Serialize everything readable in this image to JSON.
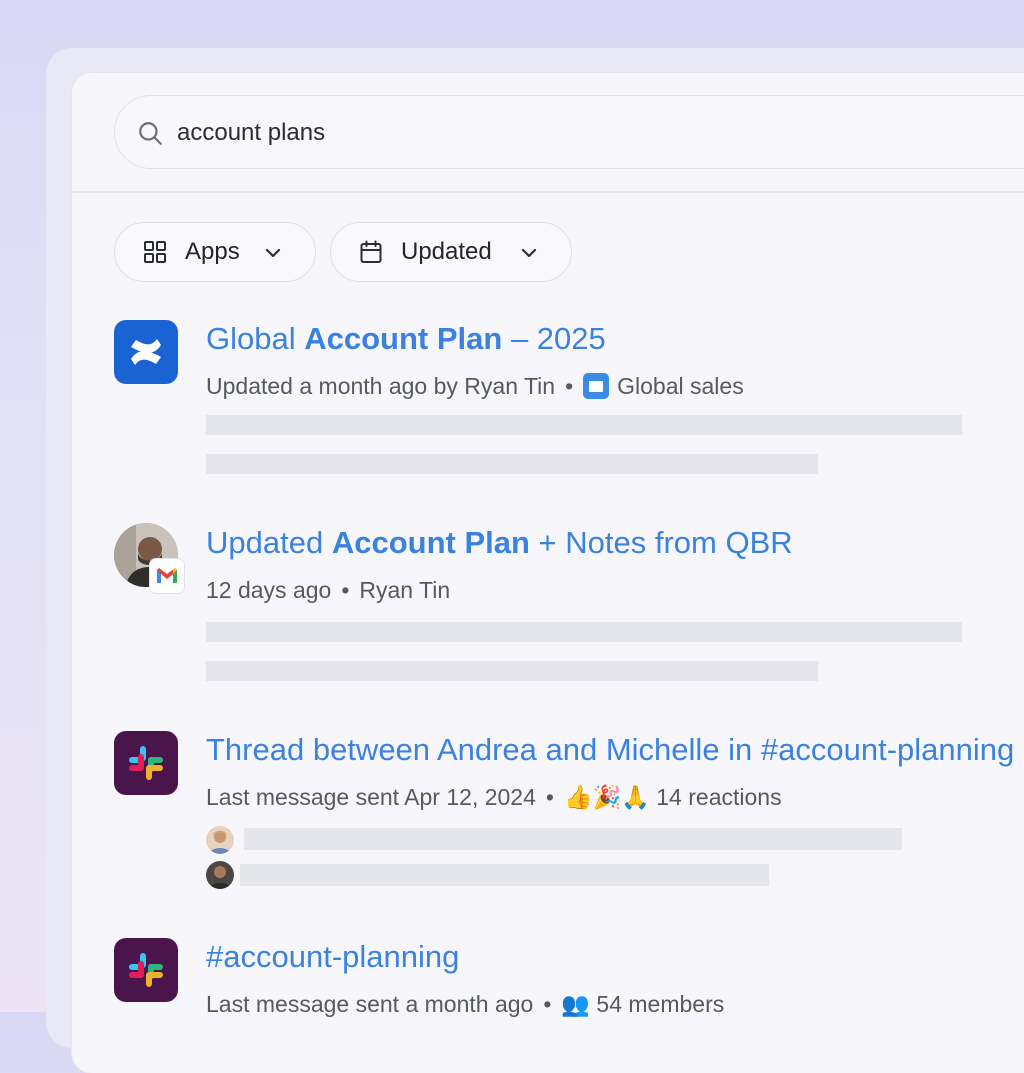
{
  "search": {
    "query": "account plans"
  },
  "filters": [
    {
      "label": "Apps",
      "icon": "grid-icon"
    },
    {
      "label": "Updated",
      "icon": "calendar-icon"
    }
  ],
  "results": [
    {
      "app_icon": "confluence-icon",
      "title_parts": [
        "Global ",
        "Account Plan",
        " – 2025"
      ],
      "meta": "Updated a month ago by Ryan Tin",
      "space": "Global sales"
    },
    {
      "app_icon": "gmail-icon",
      "title_parts": [
        "Updated ",
        "Account Plan",
        " + Notes from QBR"
      ],
      "meta_time": "12 days ago",
      "meta_author": "Ryan Tin"
    },
    {
      "app_icon": "slack-icon",
      "title": "Thread between Andrea and Michelle in #account-planning",
      "meta": "Last message sent Apr 12, 2024",
      "reactions_emoji": "👍🎉🙏",
      "reactions": "14 reactions"
    },
    {
      "app_icon": "slack-icon",
      "title": "#account-planning",
      "meta": "Last message sent a month ago",
      "members_emoji": "👥",
      "members": "54 members"
    }
  ],
  "colors": {
    "accent": "#3b82e0",
    "confluence": "#1a63d4",
    "slack": "#4a154b"
  }
}
